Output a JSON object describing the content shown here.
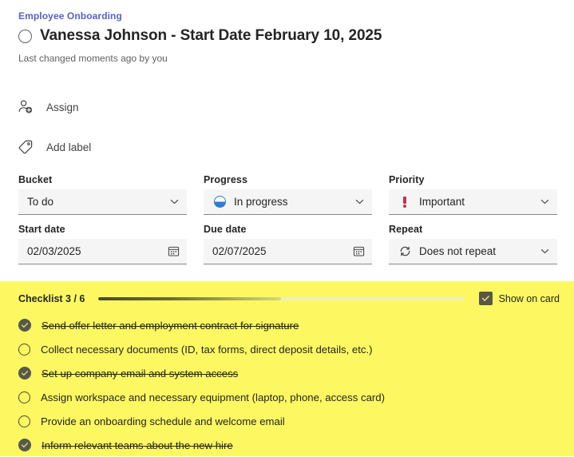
{
  "breadcrumb": {
    "label": "Employee Onboarding"
  },
  "header": {
    "title": "Vanessa Johnson - Start Date February 10, 2025",
    "subtitle": "Last changed moments ago by you",
    "complete_toggle_icon": "circle-outline-icon"
  },
  "actions": [
    {
      "icon": "person-add-icon",
      "label": "Assign"
    },
    {
      "icon": "tag-icon",
      "label": "Add label"
    }
  ],
  "fields": {
    "bucket": {
      "label": "Bucket",
      "value": "To do",
      "icon": "chevron-down-icon"
    },
    "progress": {
      "label": "Progress",
      "value": "In progress",
      "leading_icon": "progress-half-circle-icon",
      "icon": "chevron-down-icon"
    },
    "priority": {
      "label": "Priority",
      "value": "Important",
      "leading_icon": "important-exclamation-icon",
      "icon": "chevron-down-icon"
    },
    "start_date": {
      "label": "Start date",
      "value": "02/03/2025",
      "icon": "calendar-icon"
    },
    "due_date": {
      "label": "Due date",
      "value": "02/07/2025",
      "icon": "calendar-icon"
    },
    "repeat": {
      "label": "Repeat",
      "value": "Does not repeat",
      "leading_icon": "repeat-icon",
      "icon": "chevron-down-icon"
    }
  },
  "checklist": {
    "title": "Checklist 3 / 6",
    "completed": 3,
    "total": 6,
    "progress_percent": 50,
    "show_on_card_label": "Show on card",
    "show_on_card_checked": true,
    "items": [
      {
        "text": "Send offer letter and employment contract for signature",
        "done": true
      },
      {
        "text": "Collect necessary documents (ID, tax forms, direct deposit details, etc.)",
        "done": false
      },
      {
        "text": "Set up company email and system access",
        "done": true
      },
      {
        "text": "Assign workspace and necessary equipment (laptop, phone, access card)",
        "done": false
      },
      {
        "text": "Provide an onboarding schedule and welcome email",
        "done": false
      },
      {
        "text": "Inform relevant teams about the new hire",
        "done": true
      }
    ]
  },
  "colors": {
    "accent": "#5b5fc7",
    "highlight": "#fdf861",
    "priority": "#c4314b",
    "progress": "#2b7cd3",
    "field_bg": "#f5f5f5"
  }
}
